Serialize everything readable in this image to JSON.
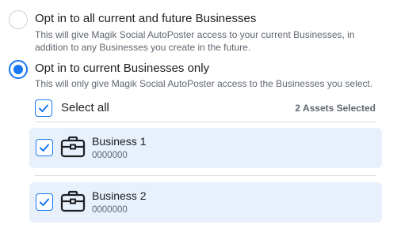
{
  "options": [
    {
      "title": "Opt in to all current and future Businesses",
      "description": "This will give Magik Social AutoPoster access to your current Businesses, in addition to any Businesses you create in the future.",
      "selected": false
    },
    {
      "title": "Opt in to current Businesses only",
      "description": "This will only give Magik Social AutoPoster access to the Businesses you select.",
      "selected": true
    }
  ],
  "select_all": {
    "label": "Select all",
    "checked": true
  },
  "assets_selected": "2 Assets Selected",
  "businesses": [
    {
      "name": "Business 1",
      "id": "0000000",
      "checked": true,
      "icon": "briefcase-icon"
    },
    {
      "name": "Business 2",
      "id": "0000000",
      "checked": true,
      "icon": "briefcase-icon"
    }
  ],
  "colors": {
    "accent": "#1877f2",
    "card_bg": "#e7f0fb",
    "secondary_text": "#606770"
  }
}
